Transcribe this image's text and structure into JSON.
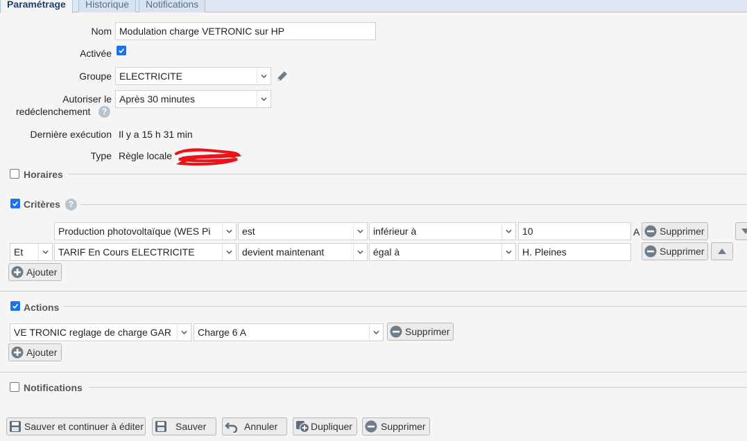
{
  "tabs": [
    "Paramétrage",
    "Historique",
    "Notifications"
  ],
  "form": {
    "nom_label": "Nom",
    "nom_value": "Modulation charge VETRONIC sur HP",
    "activee_label": "Activée",
    "groupe_label": "Groupe",
    "groupe_value": "ELECTRICITE",
    "autoriser_label_1": "Autoriser le",
    "autoriser_label_2": "redéclenchement",
    "autoriser_value": "Après 30 minutes",
    "derniere_label": "Dernière exécution",
    "derniere_value": "Il y a 15 h 31 min",
    "type_label": "Type",
    "type_value": "Règle locale"
  },
  "sections": {
    "horaires": "Horaires",
    "criteres": "Critères",
    "actions": "Actions",
    "notifications": "Notifications"
  },
  "criteria": [
    {
      "conj": "",
      "device": "Production photovoltaïque (WES Pi",
      "verb": "est",
      "op": "inférieur à",
      "value": "10",
      "unit": "A",
      "remove": "Supprimer"
    },
    {
      "conj": "Et",
      "device": "TARIF En Cours ELECTRICITE",
      "verb": "devient maintenant",
      "op": "égal à",
      "value": "H. Pleines",
      "unit": "",
      "remove": "Supprimer"
    }
  ],
  "actions": [
    {
      "device": "VE TRONIC reglage de charge GAR",
      "value": "Charge 6 A",
      "remove": "Supprimer"
    }
  ],
  "add_label": "Ajouter",
  "buttons": {
    "save_continue": "Sauver et continuer à éditer",
    "save": "Sauver",
    "cancel": "Annuler",
    "duplicate": "Dupliquer",
    "delete": "Supprimer"
  },
  "colors": {
    "accent": "#1a73e8",
    "tab_active": "#1d3f6e"
  }
}
